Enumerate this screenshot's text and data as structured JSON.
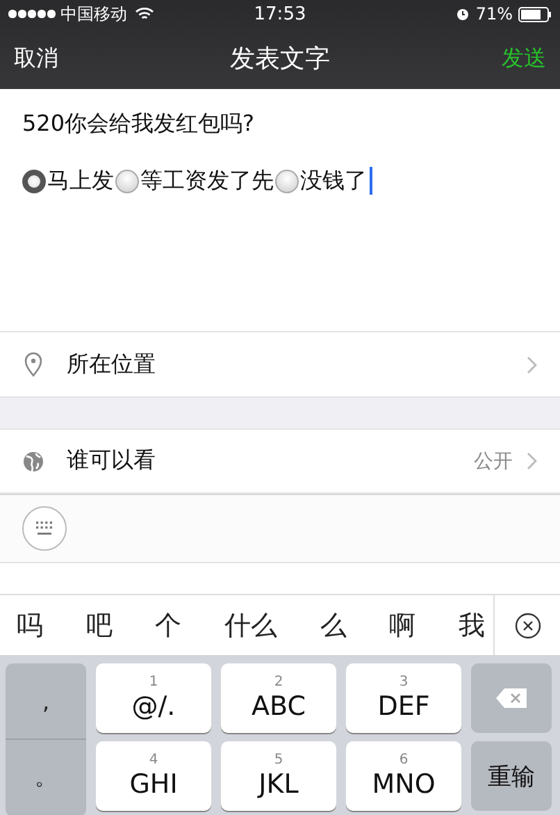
{
  "status_bar": {
    "carrier": "中国移动",
    "time": "17:53",
    "battery": "71%"
  },
  "nav": {
    "cancel": "取消",
    "title": "发表文字",
    "send": "发送"
  },
  "post": {
    "question": "520你会给我发红包吗?",
    "options": [
      {
        "label": "马上发",
        "selected": true
      },
      {
        "label": "等工资发了先",
        "selected": false
      },
      {
        "label": "没钱了",
        "selected": false
      }
    ]
  },
  "location": {
    "label": "所在位置"
  },
  "visibility": {
    "label": "谁可以看",
    "value": "公开"
  },
  "candidates": [
    "吗",
    "吧",
    "个",
    "什么",
    "么",
    "啊",
    "我"
  ],
  "keyboard": {
    "side_keys": [
      ",",
      "。"
    ],
    "keys": [
      {
        "number": "1",
        "label": "@/."
      },
      {
        "number": "2",
        "label": "ABC"
      },
      {
        "number": "3",
        "label": "DEF"
      },
      {
        "number": "4",
        "label": "GHI"
      },
      {
        "number": "5",
        "label": "JKL"
      },
      {
        "number": "6",
        "label": "MNO"
      }
    ],
    "retype": "重输"
  }
}
